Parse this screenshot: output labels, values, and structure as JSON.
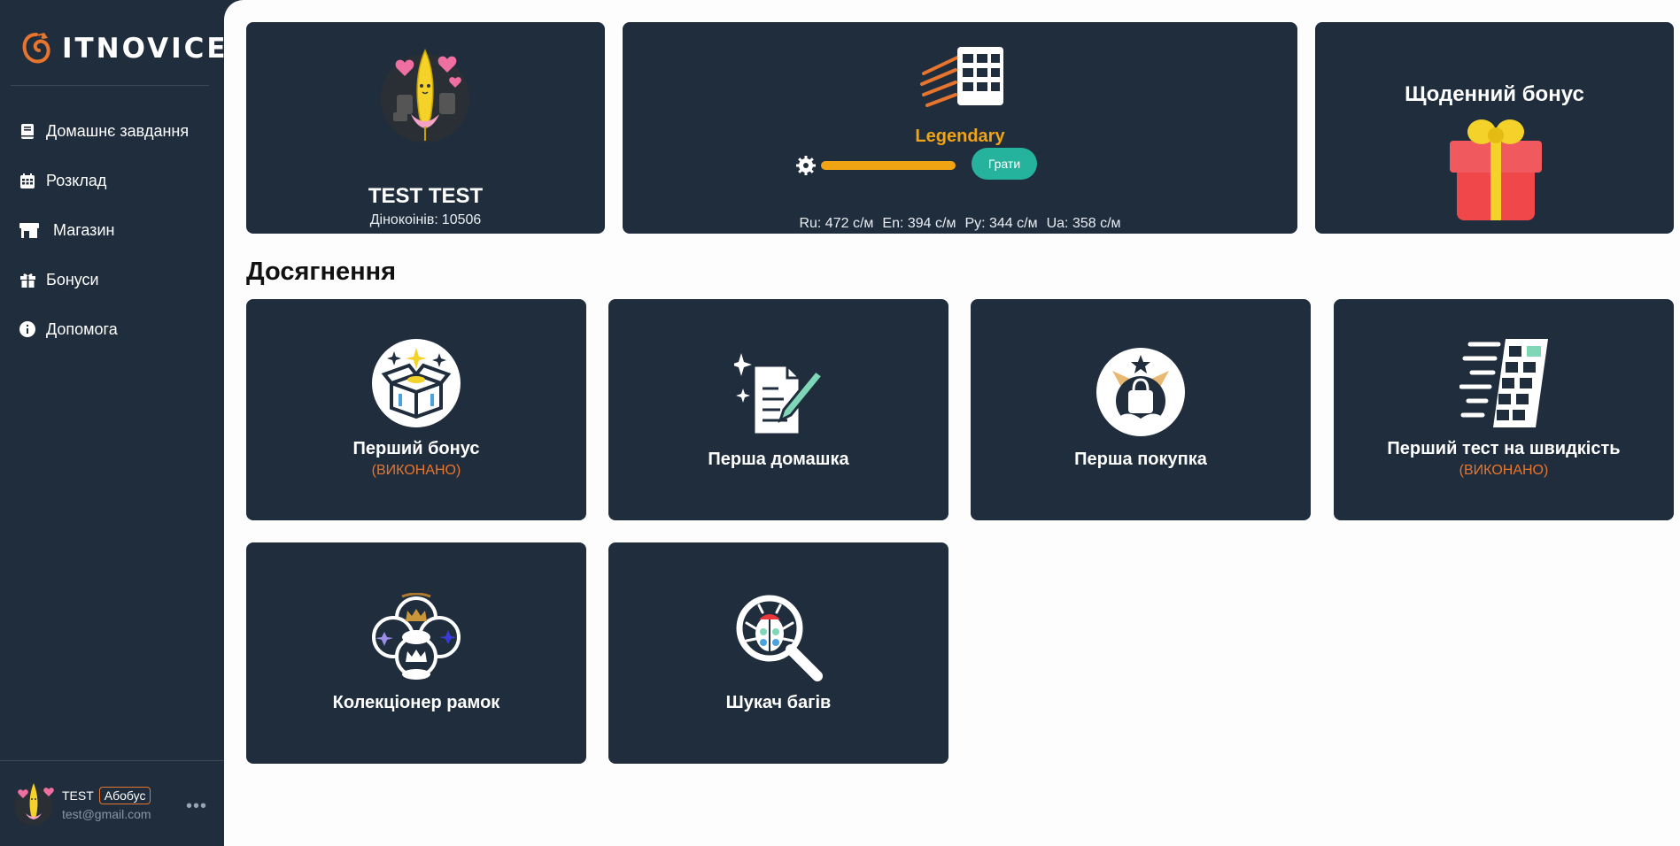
{
  "brand": {
    "name": "ITNOVICE",
    "accent": "#e8752e"
  },
  "sidebar": {
    "items": [
      {
        "label": "Домашнє завдання",
        "icon": "book-icon"
      },
      {
        "label": "Розклад",
        "icon": "calendar-icon"
      },
      {
        "label": "Магазин",
        "icon": "store-icon"
      },
      {
        "label": "Бонуси",
        "icon": "gift-icon"
      },
      {
        "label": "Допомога",
        "icon": "info-icon"
      }
    ]
  },
  "user": {
    "name": "TEST",
    "badge": "Абобус",
    "email": "test@gmail.com"
  },
  "profile": {
    "name": "TEST TEST",
    "coins_label": "Дінокоінів:",
    "coins_value": "10506"
  },
  "speed": {
    "level": "Legendary",
    "level_color": "#f0a414",
    "play_label": "Грати",
    "progress": 1.0,
    "stats": [
      "Ru: 472 с/м",
      "En: 394 с/м",
      "Ру: 344 с/м",
      "Ua: 358 с/м"
    ]
  },
  "bonus": {
    "title": "Щоденний бонус"
  },
  "achievements": {
    "title": "Досягнення",
    "items": [
      {
        "title": "Перший бонус",
        "status": "(ВИКОНАНО)",
        "icon": "box-icon"
      },
      {
        "title": "Перша домашка",
        "status": "",
        "icon": "homework-icon"
      },
      {
        "title": "Перша покупка",
        "status": "",
        "icon": "shopping-bag-icon"
      },
      {
        "title": "Перший тест на швидкість",
        "status": "(ВИКОНАНО)",
        "icon": "speed-test-icon"
      },
      {
        "title": "Колекціонер рамок",
        "status": "",
        "icon": "frames-icon"
      },
      {
        "title": "Шукач багів",
        "status": "",
        "icon": "bug-search-icon"
      }
    ]
  }
}
